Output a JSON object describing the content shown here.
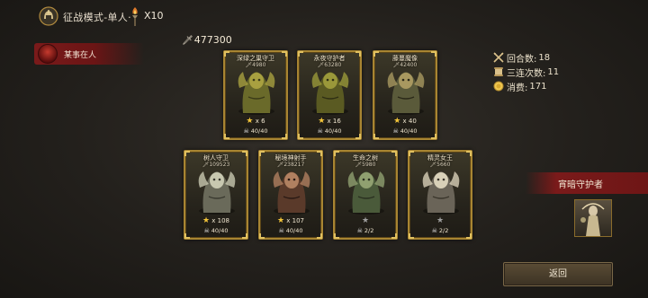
{
  "header": {
    "mode_title": "征战模式-单人·",
    "torch_count": "X10"
  },
  "player": {
    "name": "某事在人"
  },
  "team_power": "477300",
  "enemies": [
    {
      "name": "深绿之巢守卫",
      "power": "4980",
      "stars": "x 6",
      "hp": "40/40"
    },
    {
      "name": "永夜守护者",
      "power": "63280",
      "stars": "x 16",
      "hp": "40/40"
    },
    {
      "name": "藤蔓魔像",
      "power": "42400",
      "stars": "x 40",
      "hp": "40/40"
    },
    {
      "name": "树人守卫",
      "power": "109523",
      "stars": "x 108",
      "hp": "40/40"
    },
    {
      "name": "秘境神射手",
      "power": "238217",
      "stars": "x 107",
      "hp": "40/40"
    },
    {
      "name": "生命之树",
      "power": "5980",
      "stars": "",
      "hp": "2/2"
    },
    {
      "name": "精灵女王",
      "power": "5660",
      "stars": "",
      "hp": "2/2"
    }
  ],
  "stats": {
    "rounds_label": "回合数:",
    "rounds_value": "18",
    "triple_label": "三连次数:",
    "triple_value": "11",
    "cost_label": "消费:",
    "cost_value": "171"
  },
  "boss": {
    "label": "宵暗守护者"
  },
  "return_button": "返回",
  "colors": {
    "card_border": "#a88532",
    "banner_red": "#7a1a1a",
    "star_gold": "#f3c53a"
  }
}
